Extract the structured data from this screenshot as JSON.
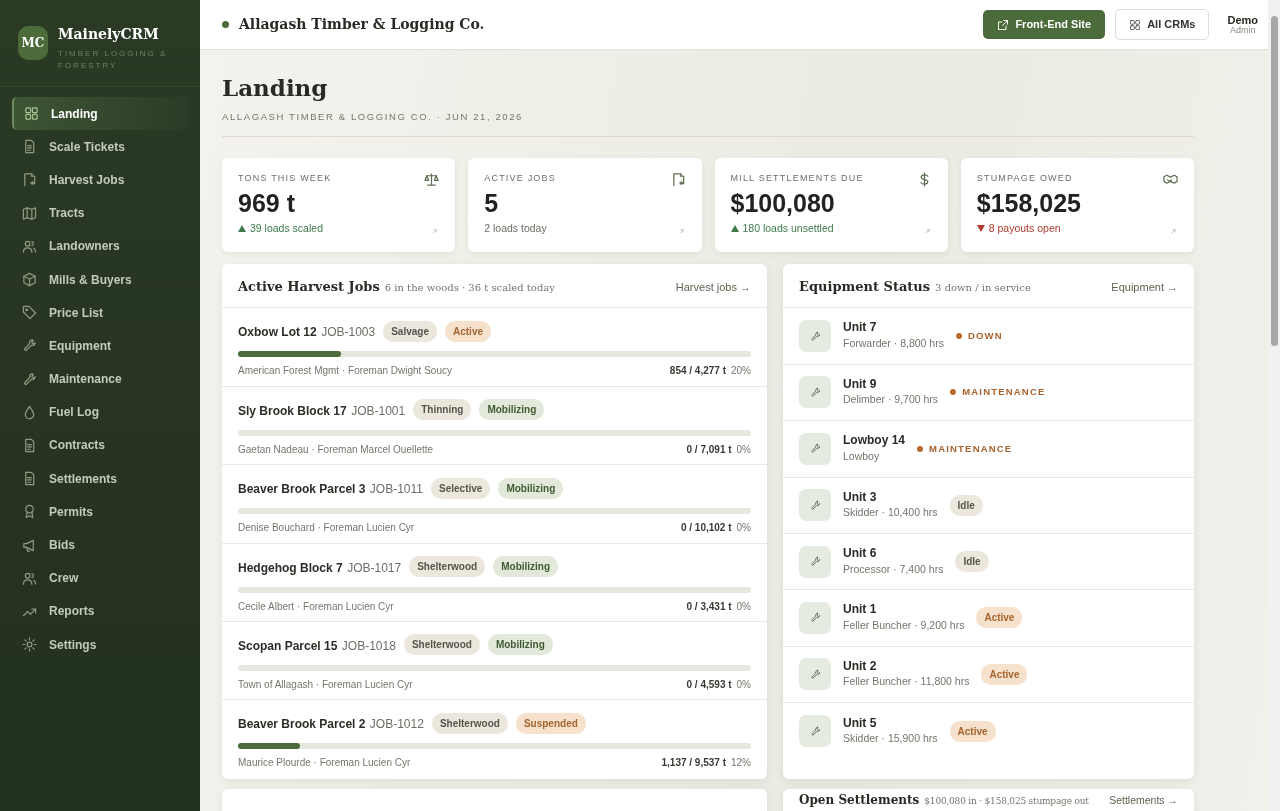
{
  "sidebar": {
    "brand": {
      "initials": "MC",
      "name": "MainelyCRM",
      "tagline": "TIMBER LOGGING & FORESTRY"
    },
    "items": [
      {
        "label": "Landing",
        "selected": true
      },
      {
        "label": "Scale Tickets",
        "selected": false
      },
      {
        "label": "Harvest Jobs",
        "selected": false
      },
      {
        "label": "Tracts",
        "selected": false
      },
      {
        "label": "Landowners",
        "selected": false
      },
      {
        "label": "Mills & Buyers",
        "selected": false
      },
      {
        "label": "Price List",
        "selected": false
      },
      {
        "label": "Equipment",
        "selected": false
      },
      {
        "label": "Maintenance",
        "selected": false
      },
      {
        "label": "Fuel Log",
        "selected": false
      },
      {
        "label": "Contracts",
        "selected": false
      },
      {
        "label": "Settlements",
        "selected": false
      },
      {
        "label": "Permits",
        "selected": false
      },
      {
        "label": "Bids",
        "selected": false
      },
      {
        "label": "Crew",
        "selected": false
      },
      {
        "label": "Reports",
        "selected": false
      },
      {
        "label": "Settings",
        "selected": false
      }
    ]
  },
  "topbar": {
    "company": "Allagash Timber & Logging Co.",
    "buttons": [
      {
        "label": "Front-End Site",
        "kind": "primary"
      },
      {
        "label": "All CRMs",
        "kind": "outline"
      }
    ],
    "user": {
      "name": "Demo",
      "role": "Admin"
    }
  },
  "page": {
    "title": "Landing",
    "subtitle": "ALLAGASH TIMBER & LOGGING CO. · JUN 21, 2026"
  },
  "stats": [
    {
      "label": "TONS THIS WEEK",
      "value": "969 t",
      "note": "39 loads scaled",
      "kind": "rising"
    },
    {
      "label": "ACTIVE JOBS",
      "value": "5",
      "note": "2 loads today",
      "kind": "plain"
    },
    {
      "label": "MILL SETTLEMENTS DUE",
      "value": "$100,080",
      "note": "180 loads unsettled",
      "kind": "rising"
    },
    {
      "label": "STUMPAGE OWED",
      "value": "$158,025",
      "note": "8 payouts open",
      "kind": "falling"
    }
  ],
  "jobs": {
    "title": "Active Harvest Jobs",
    "subtitle": "6 in the woods · 36 t scaled today",
    "link": "Harvest jobs →",
    "rows": [
      {
        "name": "Oxbow Lot 12",
        "code": "JOB-1003",
        "tags": [
          {
            "label": "Salvage",
            "kind": "neutral"
          },
          {
            "label": "Active",
            "kind": "warm"
          }
        ],
        "level": 0.2,
        "people": "American Forest Mgmt · Foreman Dwight Soucy",
        "tons": "854 / 4,277 t",
        "percent": "20%"
      },
      {
        "name": "Sly Brook Block 17",
        "code": "JOB-1001",
        "tags": [
          {
            "label": "Thinning",
            "kind": "neutral"
          },
          {
            "label": "Mobilizing",
            "kind": "green"
          }
        ],
        "level": 0,
        "people": "Gaetan Nadeau · Foreman Marcel Ouellette",
        "tons": "0 / 7,091 t",
        "percent": "0%"
      },
      {
        "name": "Beaver Brook Parcel 3",
        "code": "JOB-1011",
        "tags": [
          {
            "label": "Selective",
            "kind": "neutral"
          },
          {
            "label": "Mobilizing",
            "kind": "green"
          }
        ],
        "level": 0,
        "people": "Denise Bouchard · Foreman Lucien Cyr",
        "tons": "0 / 10,102 t",
        "percent": "0%"
      },
      {
        "name": "Hedgehog Block 7",
        "code": "JOB-1017",
        "tags": [
          {
            "label": "Shelterwood",
            "kind": "neutral"
          },
          {
            "label": "Mobilizing",
            "kind": "green"
          }
        ],
        "level": 0,
        "people": "Cecile Albert · Foreman Lucien Cyr",
        "tons": "0 / 3,431 t",
        "percent": "0%"
      },
      {
        "name": "Scopan Parcel 15",
        "code": "JOB-1018",
        "tags": [
          {
            "label": "Shelterwood",
            "kind": "neutral"
          },
          {
            "label": "Mobilizing",
            "kind": "green"
          }
        ],
        "level": 0,
        "people": "Town of Allagash · Foreman Lucien Cyr",
        "tons": "0 / 4,593 t",
        "percent": "0%"
      },
      {
        "name": "Beaver Brook Parcel 2",
        "code": "JOB-1012",
        "tags": [
          {
            "label": "Shelterwood",
            "kind": "neutral"
          },
          {
            "label": "Suspended",
            "kind": "warm"
          }
        ],
        "level": 0.12,
        "people": "Maurice Plourde · Foreman Lucien Cyr",
        "tons": "1,137 / 9,537 t",
        "percent": "12%"
      }
    ]
  },
  "equipment": {
    "title": "Equipment Status",
    "subtitle": "3 down / in service",
    "link": "Equipment →",
    "rows": [
      {
        "name": "Unit 7",
        "detail": "Forwarder · 8,800 hrs",
        "status": "DOWN",
        "kind": "alert"
      },
      {
        "name": "Unit 9",
        "detail": "Delimber · 9,700 hrs",
        "status": "MAINTENANCE",
        "kind": "alert"
      },
      {
        "name": "Lowboy 14",
        "detail": "Lowboy",
        "status": "MAINTENANCE",
        "kind": "alert"
      },
      {
        "name": "Unit 3",
        "detail": "Skidder · 10,400 hrs",
        "status": "Idle",
        "kind": "idle"
      },
      {
        "name": "Unit 6",
        "detail": "Processor · 7,400 hrs",
        "status": "Idle",
        "kind": "idle"
      },
      {
        "name": "Unit 1",
        "detail": "Feller Buncher · 9,200 hrs",
        "status": "Active",
        "kind": "active"
      },
      {
        "name": "Unit 2",
        "detail": "Feller Buncher · 11,800 hrs",
        "status": "Active",
        "kind": "active"
      },
      {
        "name": "Unit 5",
        "detail": "Skidder · 15,900 hrs",
        "status": "Active",
        "kind": "active"
      }
    ]
  },
  "settlements": {
    "title": "Open Settlements",
    "subtitle": "$100,080 in · $158,025 stumpage out",
    "link": "Settlements →"
  }
}
